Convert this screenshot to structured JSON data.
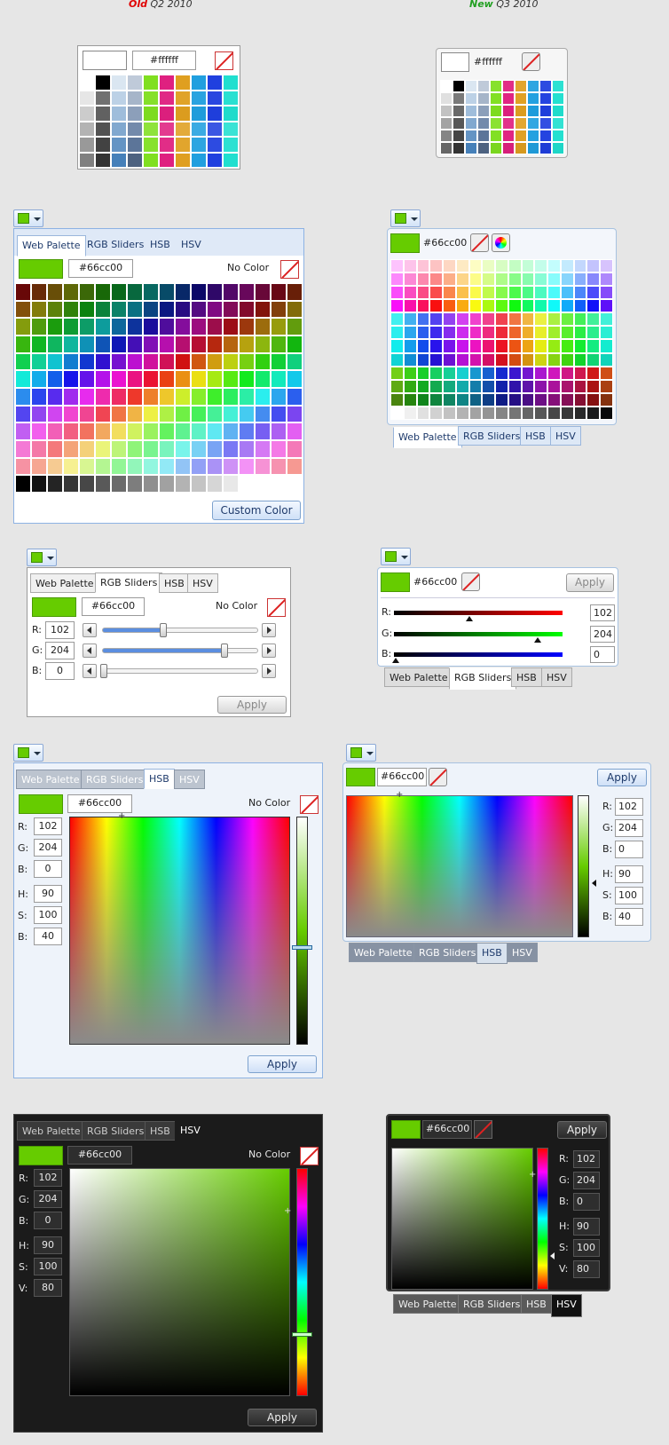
{
  "headers": {
    "old_label": "Old",
    "old_rest": " Q2 2010",
    "new_label": "New",
    "new_rest": " Q3 2010"
  },
  "colors": {
    "selected": "#66cc00",
    "white": "#ffffff"
  },
  "common": {
    "hex_white": "#ffffff",
    "hex_value": "#66cc00",
    "no_color": "No Color",
    "apply": "Apply",
    "custom_color": "Custom Color"
  },
  "tabs": {
    "web_palette": "Web Palette",
    "rgb_sliders": "RGB Sliders",
    "hsb": "HSB",
    "hsv": "HSV"
  },
  "labels": {
    "r": "R:",
    "g": "G:",
    "b": "B:",
    "h": "H:",
    "s": "S:",
    "v": "V:"
  },
  "values": {
    "r": "102",
    "g": "204",
    "b": "0",
    "h": "90",
    "s": "100",
    "b_hsb": "40",
    "v_hsv": "80"
  }
}
